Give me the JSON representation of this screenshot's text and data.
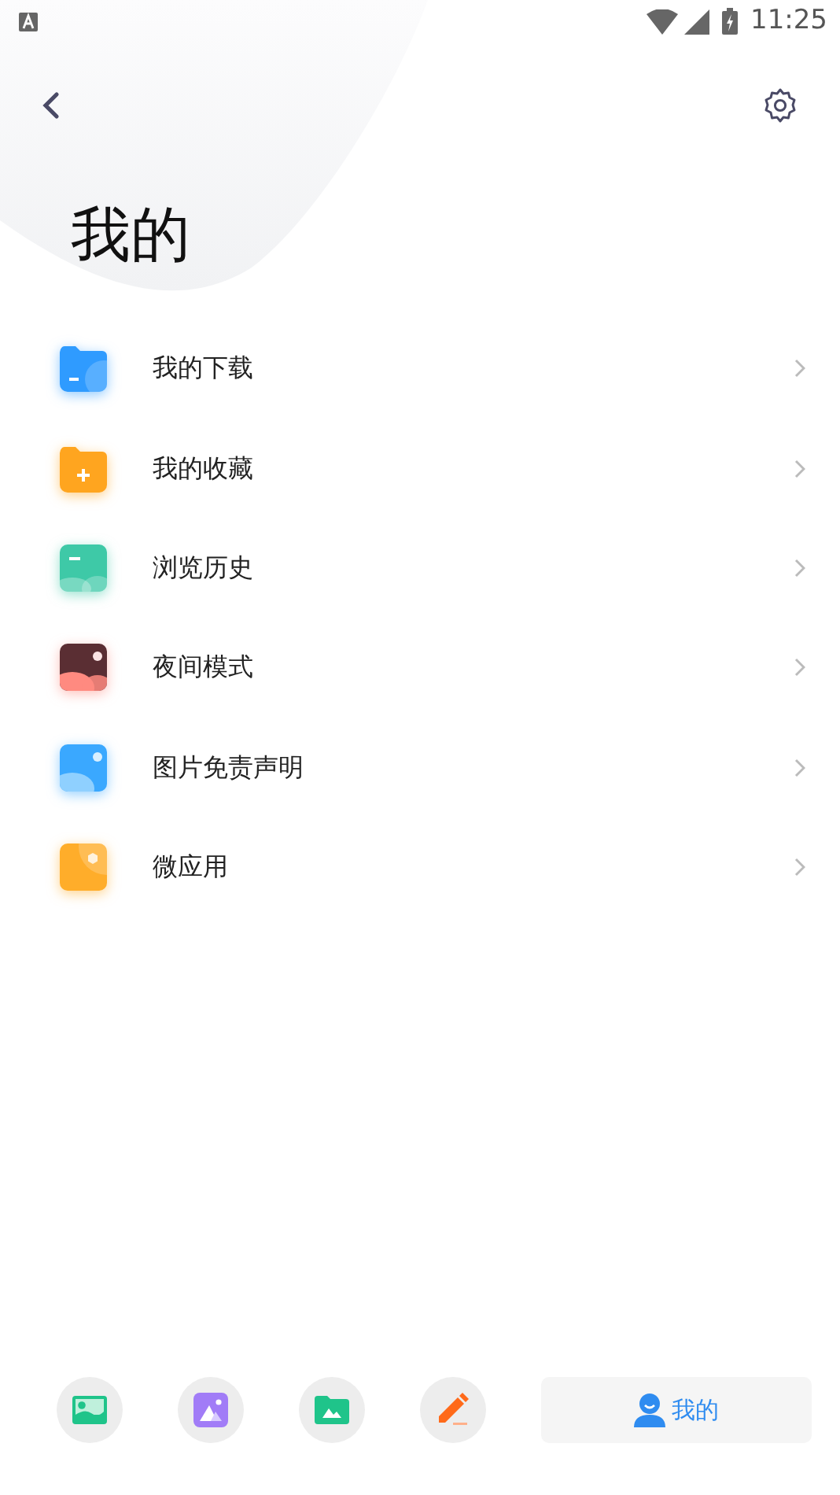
{
  "status_bar": {
    "time": "11:25"
  },
  "title": "我的",
  "menu": [
    {
      "kind": "download",
      "color": "#2f9bff",
      "label": "我的下载"
    },
    {
      "kind": "favorite",
      "color": "#ffa51f",
      "label": "我的收藏"
    },
    {
      "kind": "history",
      "color": "#3ec9a7",
      "label": "浏览历史"
    },
    {
      "kind": "night",
      "color": "#ff8a80",
      "label": "夜间模式"
    },
    {
      "kind": "disclaimer",
      "color": "#3aa8ff",
      "label": "图片免责声明"
    },
    {
      "kind": "apps",
      "color": "#ffad2a",
      "label": "微应用"
    }
  ],
  "bottom_nav": [
    {
      "kind": "image",
      "selected": false
    },
    {
      "kind": "album",
      "selected": false
    },
    {
      "kind": "folder",
      "selected": false
    },
    {
      "kind": "edit",
      "selected": false
    },
    {
      "kind": "profile",
      "label": "我的",
      "selected": true
    }
  ]
}
